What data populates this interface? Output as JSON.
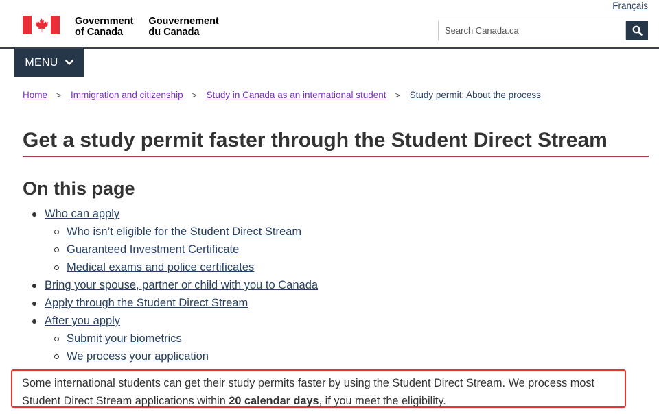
{
  "header": {
    "language_link": "Français",
    "brand_en_line1": "Government",
    "brand_en_line2": "of Canada",
    "brand_fr_line1": "Gouvernement",
    "brand_fr_line2": "du Canada",
    "flag_icon": "canada-flag-icon",
    "search_placeholder": "Search Canada.ca",
    "search_icon": "search-icon",
    "menu_label": "MENU",
    "menu_icon": "chevron-down-icon"
  },
  "breadcrumb": [
    "Home",
    "Immigration and citizenship",
    "Study in Canada as an international student",
    "Study permit: About the process"
  ],
  "breadcrumb_separator": ">",
  "page_title": "Get a study permit faster through the Student Direct Stream",
  "toc": {
    "title": "On this page",
    "items": [
      "Who can apply",
      "Who isn’t eligible for the Student Direct Stream",
      "Guaranteed Investment Certificate",
      "Medical exams and police certificates",
      "Bring your spouse, partner or child with you to Canada",
      "Apply through the Student Direct Stream",
      "After you apply",
      "Submit your biometrics",
      "We process your application"
    ]
  },
  "intro": {
    "line1": "Some international students can get their study permits faster by using the Student Direct Stream. We process most",
    "line2_before": "Student Direct Stream applications within ",
    "line2_bold": "20 calendar days",
    "line2_after": ", if you meet the eligibility."
  },
  "colors": {
    "header_dark": "#26374a",
    "link": "#284162",
    "visited_link": "#7834bc",
    "title_rule": "#af3c43",
    "highlight_border": "#e8352c",
    "flag_red": "#eb2d37"
  }
}
